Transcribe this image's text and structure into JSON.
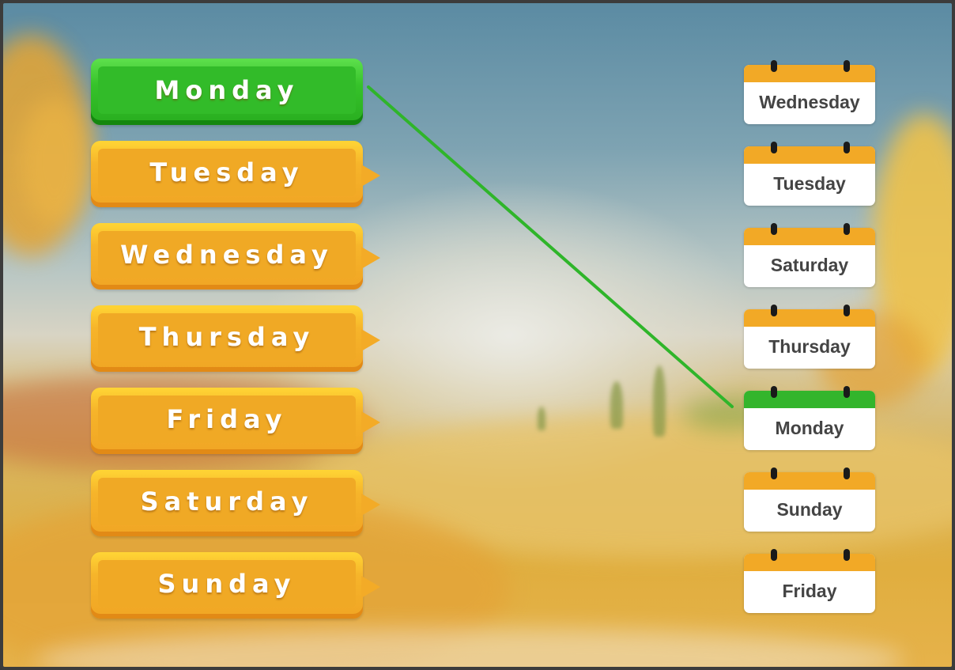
{
  "game": {
    "left_words": [
      {
        "label": "Monday",
        "state": "selected"
      },
      {
        "label": "Tuesday",
        "state": "idle"
      },
      {
        "label": "Wednesday",
        "state": "idle"
      },
      {
        "label": "Thursday",
        "state": "idle"
      },
      {
        "label": "Friday",
        "state": "idle"
      },
      {
        "label": "Saturday",
        "state": "idle"
      },
      {
        "label": "Sunday",
        "state": "idle"
      }
    ],
    "right_calendars": [
      {
        "label": "Wednesday",
        "state": "idle"
      },
      {
        "label": "Tuesday",
        "state": "idle"
      },
      {
        "label": "Saturday",
        "state": "idle"
      },
      {
        "label": "Thursday",
        "state": "idle"
      },
      {
        "label": "Monday",
        "state": "matched"
      },
      {
        "label": "Sunday",
        "state": "idle"
      },
      {
        "label": "Friday",
        "state": "idle"
      }
    ],
    "connections": [
      {
        "from": "Monday",
        "to": "Monday"
      }
    ],
    "colors": {
      "word_idle": "#f0a925",
      "word_selected": "#32bb29",
      "calendar_header": "#f2a926",
      "calendar_matched_header": "#33b52c",
      "connection_line": "#2fb52a"
    }
  }
}
